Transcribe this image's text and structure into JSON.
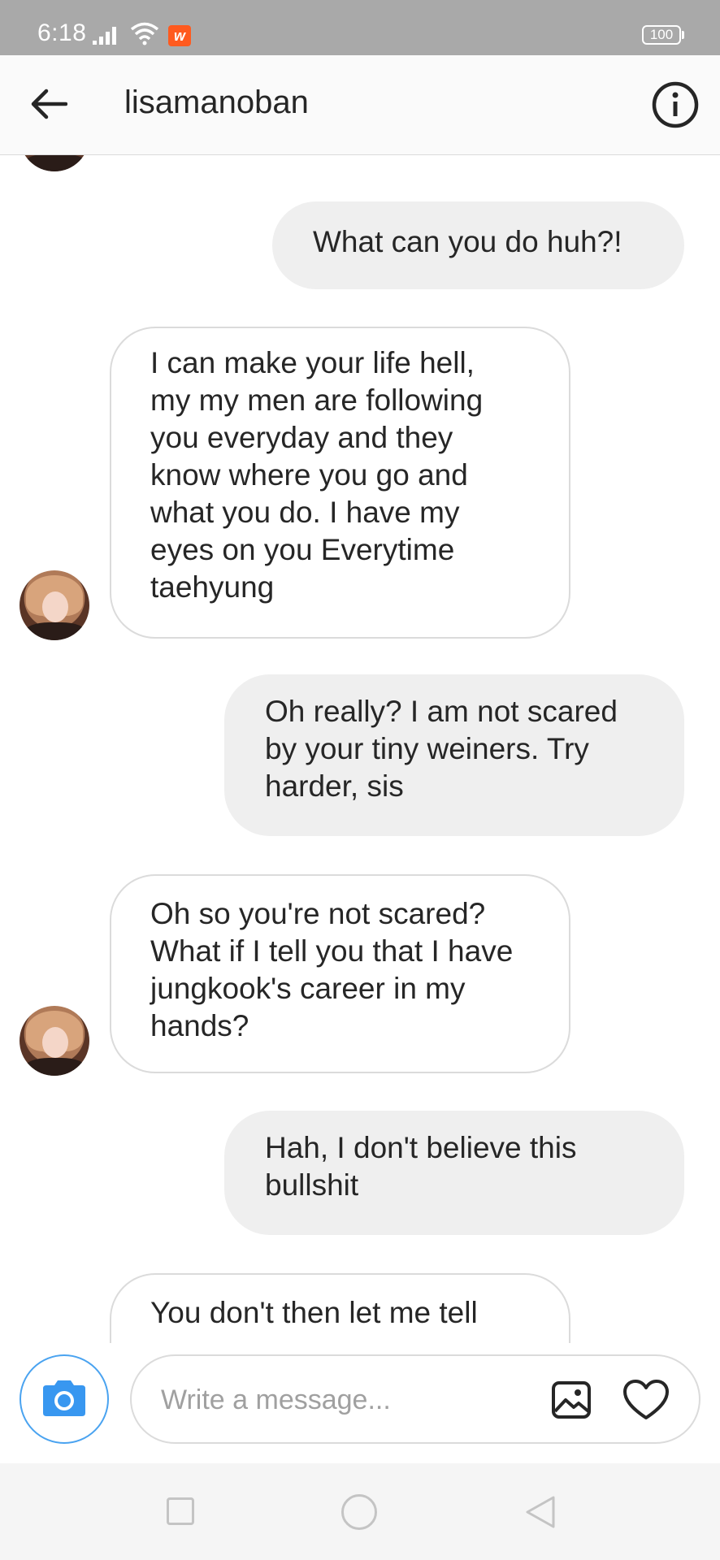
{
  "status_bar": {
    "time": "6:18",
    "battery": "100",
    "app_notification_glyph": "w",
    "icons": [
      "signal-icon",
      "wifi-icon",
      "app-notification-icon",
      "battery-icon"
    ]
  },
  "header": {
    "title": "lisamanoban",
    "back_icon": "arrow-left-icon",
    "info_icon": "info-circle-icon"
  },
  "messages": [
    {
      "direction": "out",
      "text": "What can you do huh?!"
    },
    {
      "direction": "in",
      "text": "I can make your life hell, my my men are following you everyday and they know where you go and what you do. I have my eyes on you Everytime taehyung"
    },
    {
      "direction": "out",
      "text": "Oh really? I am not scared by your tiny weiners. Try harder, sis"
    },
    {
      "direction": "in",
      "text": "Oh so you're not scared? What if I tell you that I have jungkook's career in my hands?"
    },
    {
      "direction": "out",
      "text": "Hah, I don't believe this bullshit"
    },
    {
      "direction": "in",
      "text": "You don't then let me tell"
    }
  ],
  "composer": {
    "placeholder": "Write a message...",
    "value": "",
    "icons": [
      "camera-icon",
      "gallery-icon",
      "heart-icon"
    ]
  },
  "colors": {
    "status_bar_bg": "#a9a9a9",
    "outgoing_bubble": "#efefef",
    "incoming_border": "#dbdbdb",
    "camera_blue": "#3897f0",
    "text": "#262626"
  },
  "nav_bar": {
    "icons": [
      "recent-apps-icon",
      "home-icon",
      "back-icon"
    ]
  }
}
